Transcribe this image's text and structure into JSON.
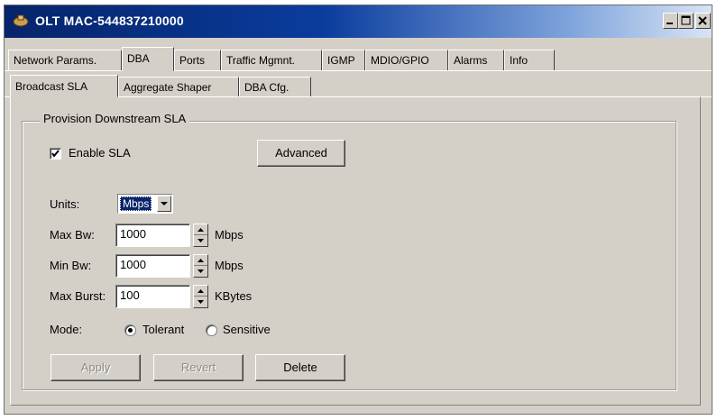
{
  "window": {
    "title": "OLT MAC-544837210000",
    "controls": {
      "minimize": "minimize-icon",
      "maximize": "maximize-icon",
      "close": "close-icon"
    }
  },
  "tabs": [
    {
      "label": "Network Params."
    },
    {
      "label": "DBA",
      "active": true
    },
    {
      "label": "Ports"
    },
    {
      "label": "Traffic Mgmnt."
    },
    {
      "label": "IGMP"
    },
    {
      "label": "MDIO/GPIO"
    },
    {
      "label": "Alarms"
    },
    {
      "label": "Info"
    }
  ],
  "subtabs": [
    {
      "label": "Broadcast SLA",
      "active": true
    },
    {
      "label": "Aggregate Shaper"
    },
    {
      "label": "DBA Cfg."
    }
  ],
  "group": {
    "legend": "Provision Downstream SLA",
    "enable_sla": {
      "label": "Enable SLA",
      "checked": true
    },
    "advanced_label": "Advanced",
    "units": {
      "label": "Units:",
      "value": "Mbps"
    },
    "max_bw": {
      "label": "Max Bw:",
      "value": "1000",
      "unit": "Mbps"
    },
    "min_bw": {
      "label": "Min Bw:",
      "value": "1000",
      "unit": "Mbps"
    },
    "max_burst": {
      "label": "Max Burst:",
      "value": "100",
      "unit": "KBytes"
    },
    "mode": {
      "label": "Mode:",
      "options": [
        "Tolerant",
        "Sensitive"
      ],
      "selected": "Tolerant"
    },
    "buttons": {
      "apply": "Apply",
      "revert": "Revert",
      "delete": "Delete"
    }
  },
  "colors": {
    "titlebar_start": "#06246a",
    "face": "#d4d0c8",
    "selection": "#0a246a"
  }
}
